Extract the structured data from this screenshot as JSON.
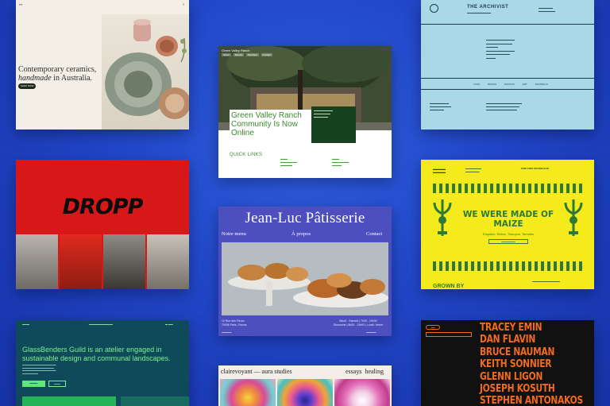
{
  "colors": {
    "background": "#2146c9",
    "dropp_red": "#d81818",
    "patisserie_purple": "#4d4fbf",
    "maize_yellow": "#f4ea1c",
    "maize_green": "#2c7a35",
    "archivist_blue": "#a9d8e6",
    "glass_teal": "#0e4a5a",
    "artists_orange": "#f26a1b"
  },
  "ceramics": {
    "headline_line1": "Contemporary ceramics,",
    "headline_em": "handmade",
    "headline_rest": " in Australia.",
    "button": "SHOP NOW"
  },
  "green_valley": {
    "logo": "Green Valley Ranch",
    "nav": [
      "About",
      "Events",
      "Services",
      "Contact"
    ],
    "title": "Green Valley Ranch Community Is Now Online",
    "quick_links": "QUICK LINKS"
  },
  "archivist": {
    "title": "THE ARCHIVIST",
    "menu": [
      "LOGS",
      "BOOKS",
      "PHOTOS",
      "ART",
      "JOURNALS"
    ]
  },
  "dropp": {
    "word": "DROPP"
  },
  "patisserie": {
    "title": "Jean-Luc Pâtisserie",
    "nav_menu": "Notre menu",
    "nav_about": "À propos",
    "nav_contact": "Contact",
    "address_line1": "12 Rue des Fleurs",
    "address_line2": "75006 Paris, France",
    "hours_line1": "Mardi - Samedi | 7h30 - 19h30",
    "hours_line2": "Dimanche | 8h00 - 13h00 | Lundi : fermé"
  },
  "maize": {
    "headline": "WE WERE MADE OF MAIZE",
    "subtitle": "Esquites, Elotes, Tlacoyos, Tamales",
    "top_line": "PURE CORN. NOTHING ELSE.",
    "grown": "GROWN BY"
  },
  "glassbenders": {
    "headline": "GlassBenders Guild is an atelier engaged in sustainable design and communal landscapes."
  },
  "clairevoyant": {
    "left": "clairevoyant — aura studies",
    "right_1": "essays",
    "right_2": "healing"
  },
  "artists": {
    "names": [
      "TRACEY EMIN",
      "DAN FLAVIN",
      "BRUCE NAUMAN",
      "KEITH SONNIER",
      "GLENN LIGON",
      "JOSEPH KOSUTH",
      "STEPHEN ANTONAKOS"
    ]
  }
}
